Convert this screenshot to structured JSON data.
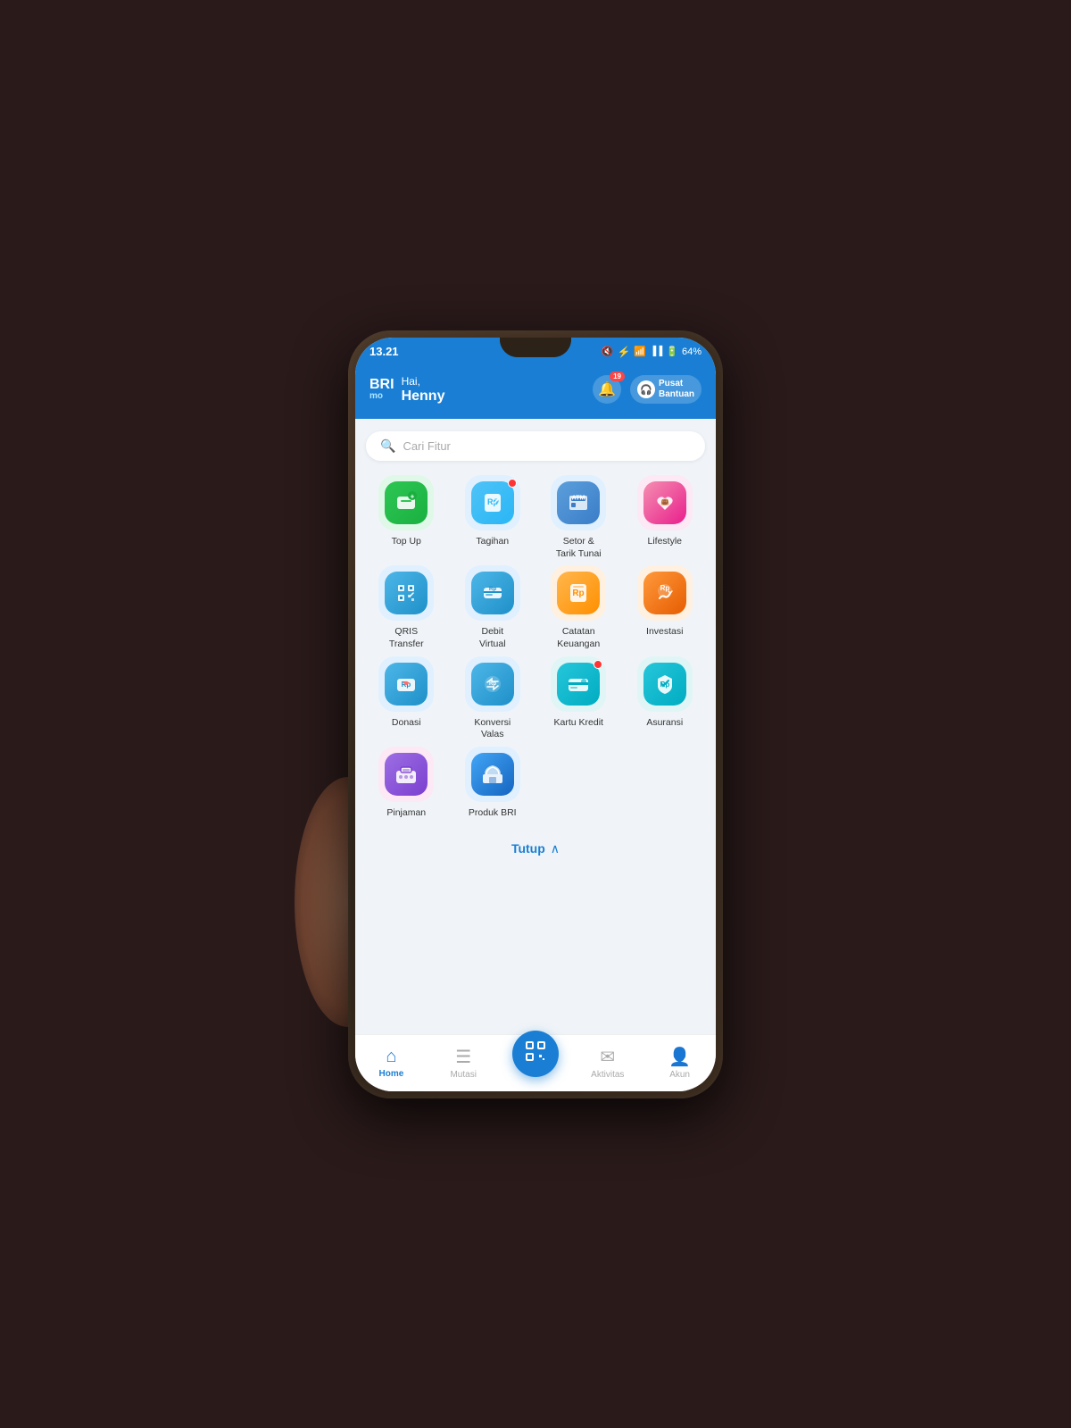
{
  "status": {
    "time": "13.21",
    "battery": "64%",
    "notif_count": "19"
  },
  "header": {
    "app_name": "BRI",
    "app_sub": "mo",
    "greeting": "Hai,",
    "user_name": "Henny",
    "help_label": "Pusat\nBantuan"
  },
  "search": {
    "placeholder": "Cari Fitur"
  },
  "menu_items": [
    {
      "id": "top-up",
      "label": "Top Up",
      "icon_type": "topup",
      "has_dot": false
    },
    {
      "id": "tagihan",
      "label": "Tagihan",
      "icon_type": "tagihan",
      "has_dot": true
    },
    {
      "id": "setor-tarik",
      "label": "Setor &\nTarik Tunai",
      "icon_type": "setor",
      "has_dot": false
    },
    {
      "id": "lifestyle",
      "label": "Lifestyle",
      "icon_type": "lifestyle",
      "has_dot": false
    },
    {
      "id": "qris-transfer",
      "label": "QRIS\nTransfer",
      "icon_type": "qris",
      "has_dot": false
    },
    {
      "id": "debit-virtual",
      "label": "Debit\nVirtual",
      "icon_type": "debit",
      "has_dot": false
    },
    {
      "id": "catatan-keuangan",
      "label": "Catatan\nKeuangan",
      "icon_type": "catatan",
      "has_dot": false
    },
    {
      "id": "investasi",
      "label": "Investasi",
      "icon_type": "investasi",
      "has_dot": false
    },
    {
      "id": "donasi",
      "label": "Donasi",
      "icon_type": "donasi",
      "has_dot": false
    },
    {
      "id": "konversi-valas",
      "label": "Konversi\nValas",
      "icon_type": "konversi",
      "has_dot": false
    },
    {
      "id": "kartu-kredit",
      "label": "Kartu Kredit",
      "icon_type": "kartu",
      "has_dot": true
    },
    {
      "id": "asuransi",
      "label": "Asuransi",
      "icon_type": "asuransi",
      "has_dot": false
    },
    {
      "id": "pinjaman",
      "label": "Pinjaman",
      "icon_type": "pinjaman",
      "has_dot": false
    },
    {
      "id": "produk-bri",
      "label": "Produk BRI",
      "icon_type": "produk",
      "has_dot": false
    }
  ],
  "close_btn": "Tutup",
  "nav": {
    "home_label": "Home",
    "mutasi_label": "Mutasi",
    "aktivitas_label": "Aktivitas",
    "akun_label": "Akun"
  }
}
